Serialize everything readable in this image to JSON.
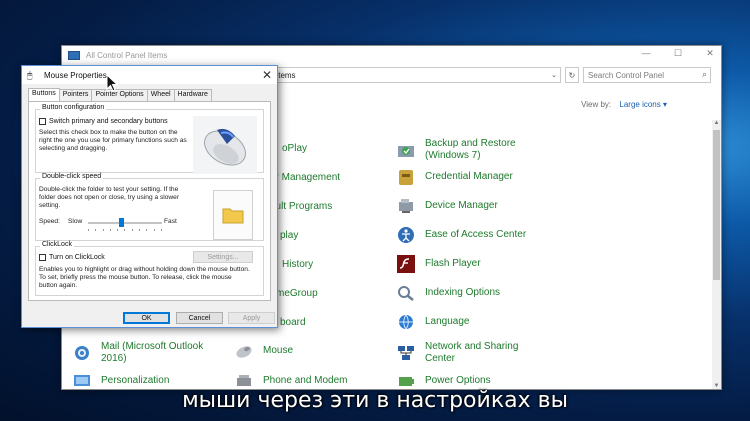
{
  "control_panel": {
    "title": "All Control Panel Items",
    "address_fragment": "Items",
    "search_placeholder": "Search Control Panel",
    "view_by_label": "View by:",
    "view_by_value": "Large icons",
    "items": [
      {
        "label": "oPlay",
        "icon": "autoplay-icon"
      },
      {
        "label": "Backup and Restore\n(Windows 7)",
        "icon": "backup-icon"
      },
      {
        "label": "or Management",
        "icon": "color-management-icon"
      },
      {
        "label": "Credential Manager",
        "icon": "credential-manager-icon"
      },
      {
        "label": "ault Programs",
        "icon": "default-programs-icon"
      },
      {
        "label": "Device Manager",
        "icon": "device-manager-icon"
      },
      {
        "label": "play",
        "icon": "display-icon"
      },
      {
        "label": "Ease of Access Center",
        "icon": "ease-of-access-icon"
      },
      {
        "label": "History",
        "icon": "file-history-icon"
      },
      {
        "label": "Flash Player",
        "icon": "flash-player-icon"
      },
      {
        "label": "meGroup",
        "icon": "homegroup-icon"
      },
      {
        "label": "Indexing Options",
        "icon": "indexing-options-icon"
      },
      {
        "label": "board",
        "icon": "keyboard-icon"
      },
      {
        "label": "Language",
        "icon": "language-icon"
      },
      {
        "label": "Mail (Microsoft Outlook\n2016)",
        "icon": "mail-icon"
      },
      {
        "label": "Mouse",
        "icon": "mouse-icon"
      },
      {
        "label": "Network and Sharing\nCenter",
        "icon": "network-sharing-icon"
      },
      {
        "label": "Personalization",
        "icon": "personalization-icon"
      },
      {
        "label": "Phone and Modem",
        "icon": "phone-modem-icon"
      },
      {
        "label": "Power Options",
        "icon": "power-options-icon"
      }
    ]
  },
  "dialog": {
    "title": "Mouse Properties",
    "tabs": [
      "Buttons",
      "Pointers",
      "Pointer Options",
      "Wheel",
      "Hardware"
    ],
    "button_config": {
      "legend": "Button configuration",
      "checkbox_label": "Switch primary and secondary buttons",
      "description": "Select this check box to make the button on the right the one you use for primary functions such as selecting and dragging."
    },
    "double_click": {
      "legend": "Double-click speed",
      "description": "Double-click the folder to test your setting. If the folder does not open or close, try using a slower setting.",
      "speed_label": "Speed:",
      "slow_label": "Slow",
      "fast_label": "Fast",
      "speed_level": 0.45
    },
    "clicklock": {
      "legend": "ClickLock",
      "checkbox_label": "Turn on ClickLock",
      "settings_label": "Settings...",
      "description": "Enables you to highlight or drag without holding down the mouse button. To set, briefly press the mouse button. To release, click the mouse button again."
    },
    "ok_label": "OK",
    "cancel_label": "Cancel",
    "apply_label": "Apply"
  },
  "subtitle": "мыши через эти  в настройках вы"
}
